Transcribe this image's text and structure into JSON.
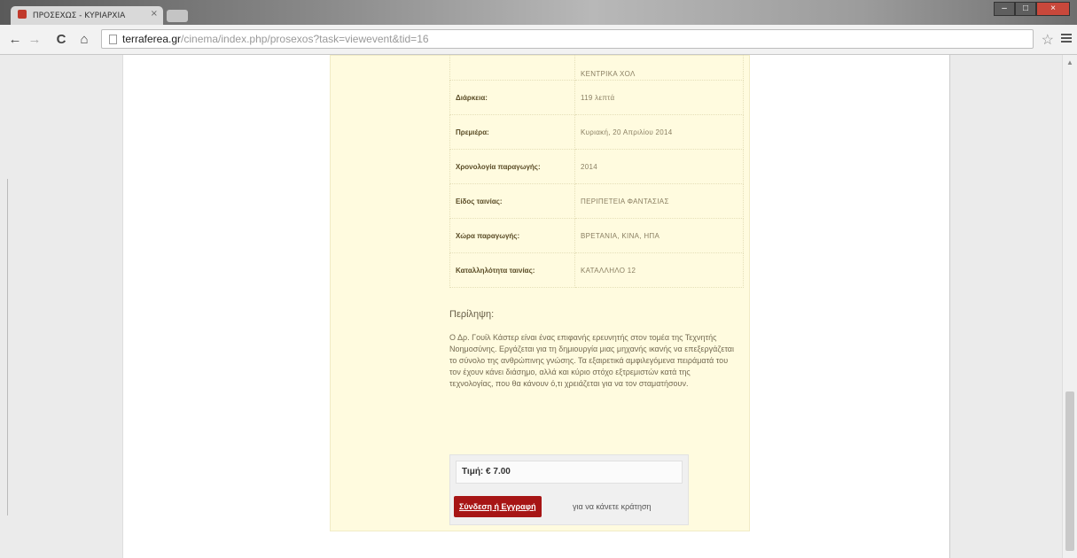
{
  "browser": {
    "tab_title": "ΠΡΟΣΕΧΩΣ - ΚΥΡΙΑΡΧΙΑ",
    "tab_close": "×",
    "url_host": "terraferea.gr",
    "url_path": "/cinema/index.php/prosexos?task=viewevent&tid=16",
    "nav": {
      "back": "←",
      "forward": "→",
      "reload": "C",
      "home": "⌂"
    },
    "star": "☆",
    "window": {
      "minimize": "–",
      "maximize": "□",
      "close": "×"
    }
  },
  "details": {
    "partial_value": "ΚΕΝΤΡΙΚΑ ΧΟΛ",
    "rows": [
      {
        "label": "Διάρκεια:",
        "value": "119 λεπτά"
      },
      {
        "label": "Πρεμιέρα:",
        "value": "Κυριακή, 20 Απριλίου 2014"
      },
      {
        "label": "Χρονολογία παραγωγής:",
        "value": "2014"
      },
      {
        "label": "Είδος ταινίας:",
        "value": "ΠΕΡΙΠΕΤΕΙΑ ΦΑΝΤΑΣΙΑΣ"
      },
      {
        "label": "Χώρα παραγωγής:",
        "value": "ΒΡΕΤΑΝΙΑ, ΚΙΝΑ, ΗΠΑ"
      },
      {
        "label": "Καταλληλότητα ταινίας:",
        "value": "ΚΑΤΑΛΛΗΛΟ 12"
      }
    ]
  },
  "synopsis": {
    "title": "Περίληψη:",
    "text": "Ο Δρ. Γουίλ Κάστερ είναι ένας επιφανής ερευνητής στον τομέα της Τεχνητής Νοημοσύνης. Εργάζεται για τη δημιουργία μιας μηχανής ικανής να επεξεργάζεται το σύνολο της ανθρώπινης γνώσης. Τα εξαιρετικά αμφιλεγόμενα πειράματά του τον έχουν κάνει διάσημο, αλλά και κύριο στόχο εξτρεμιστών κατά της τεχνολογίας, που θα κάνουν ό,τι χρειάζεται για να τον σταματήσουν."
  },
  "booking": {
    "price": "Τιμή: € 7.00",
    "login_button": "Σύνδεση ή Εγγραφή",
    "reserve_text": "για να κάνετε κράτηση"
  }
}
